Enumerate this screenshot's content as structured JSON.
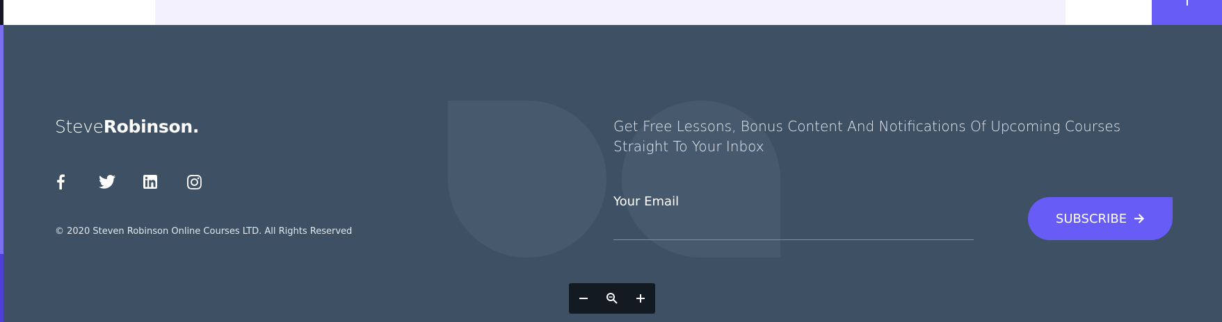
{
  "brand": {
    "logo_light": "Steve",
    "logo_bold": "Robinson."
  },
  "social": [
    "facebook-icon",
    "twitter-icon",
    "linkedin-icon",
    "instagram-icon"
  ],
  "copyright": "© 2020 Steven Robinson Online Courses LTD. All Rights Reserved",
  "newsletter": {
    "heading": "Get Free Lessons, Bonus Content And Notifications Of Upcoming Courses Straight To Your Inbox",
    "email_label": "Your Email",
    "email_value": "",
    "subscribe_label": "SUBSCRIBE"
  },
  "zoom": {
    "controls": [
      "zoom-out-icon",
      "zoom-reset-icon",
      "zoom-in-icon"
    ]
  },
  "colors": {
    "footer_bg": "#3d5064",
    "accent": "#675df6",
    "top_panel": "#f2f1fd"
  }
}
